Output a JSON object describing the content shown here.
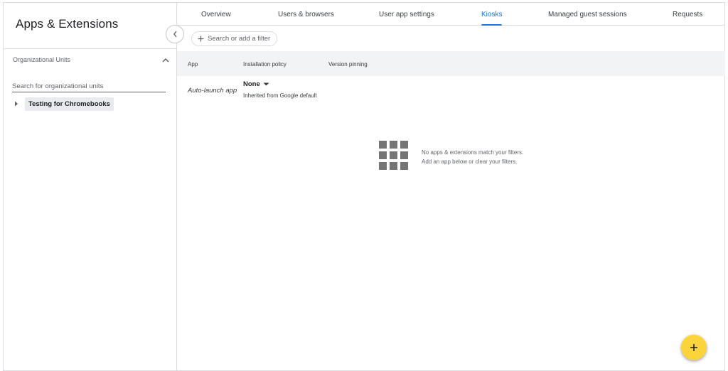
{
  "app": {
    "title": "Apps & Extensions"
  },
  "sidebar": {
    "org_units_header": "Organizational Units",
    "search_placeholder": "Search for organizational units",
    "tree": [
      {
        "label": "Testing for Chromebooks"
      }
    ]
  },
  "tabs": [
    {
      "label": "Overview"
    },
    {
      "label": "Users & browsers"
    },
    {
      "label": "User app settings"
    },
    {
      "label": "Kiosks",
      "active": true
    },
    {
      "label": "Managed guest sessions"
    },
    {
      "label": "Requests"
    }
  ],
  "filter": {
    "placeholder": "Search or add a filter"
  },
  "table": {
    "columns": [
      "App",
      "Installation policy",
      "Version pinning"
    ],
    "row": {
      "app": "Auto-launch app",
      "policy_value": "None",
      "policy_inherited": "Inherited from Google default"
    }
  },
  "empty_state": {
    "line1": "No apps & extensions match your filters.",
    "line2": "Add an app below or clear your filters."
  },
  "icons": {
    "collapse": "chevron-left-icon",
    "ou_toggle": "chevron-up-icon",
    "tree_expand": "triangle-right-icon",
    "filter_add": "plus-icon",
    "policy_dropdown": "caret-down-icon",
    "empty": "apps-grid-icon",
    "fab": "plus-icon"
  },
  "colors": {
    "accent": "#1a73e8",
    "fab": "#fbd33b"
  }
}
